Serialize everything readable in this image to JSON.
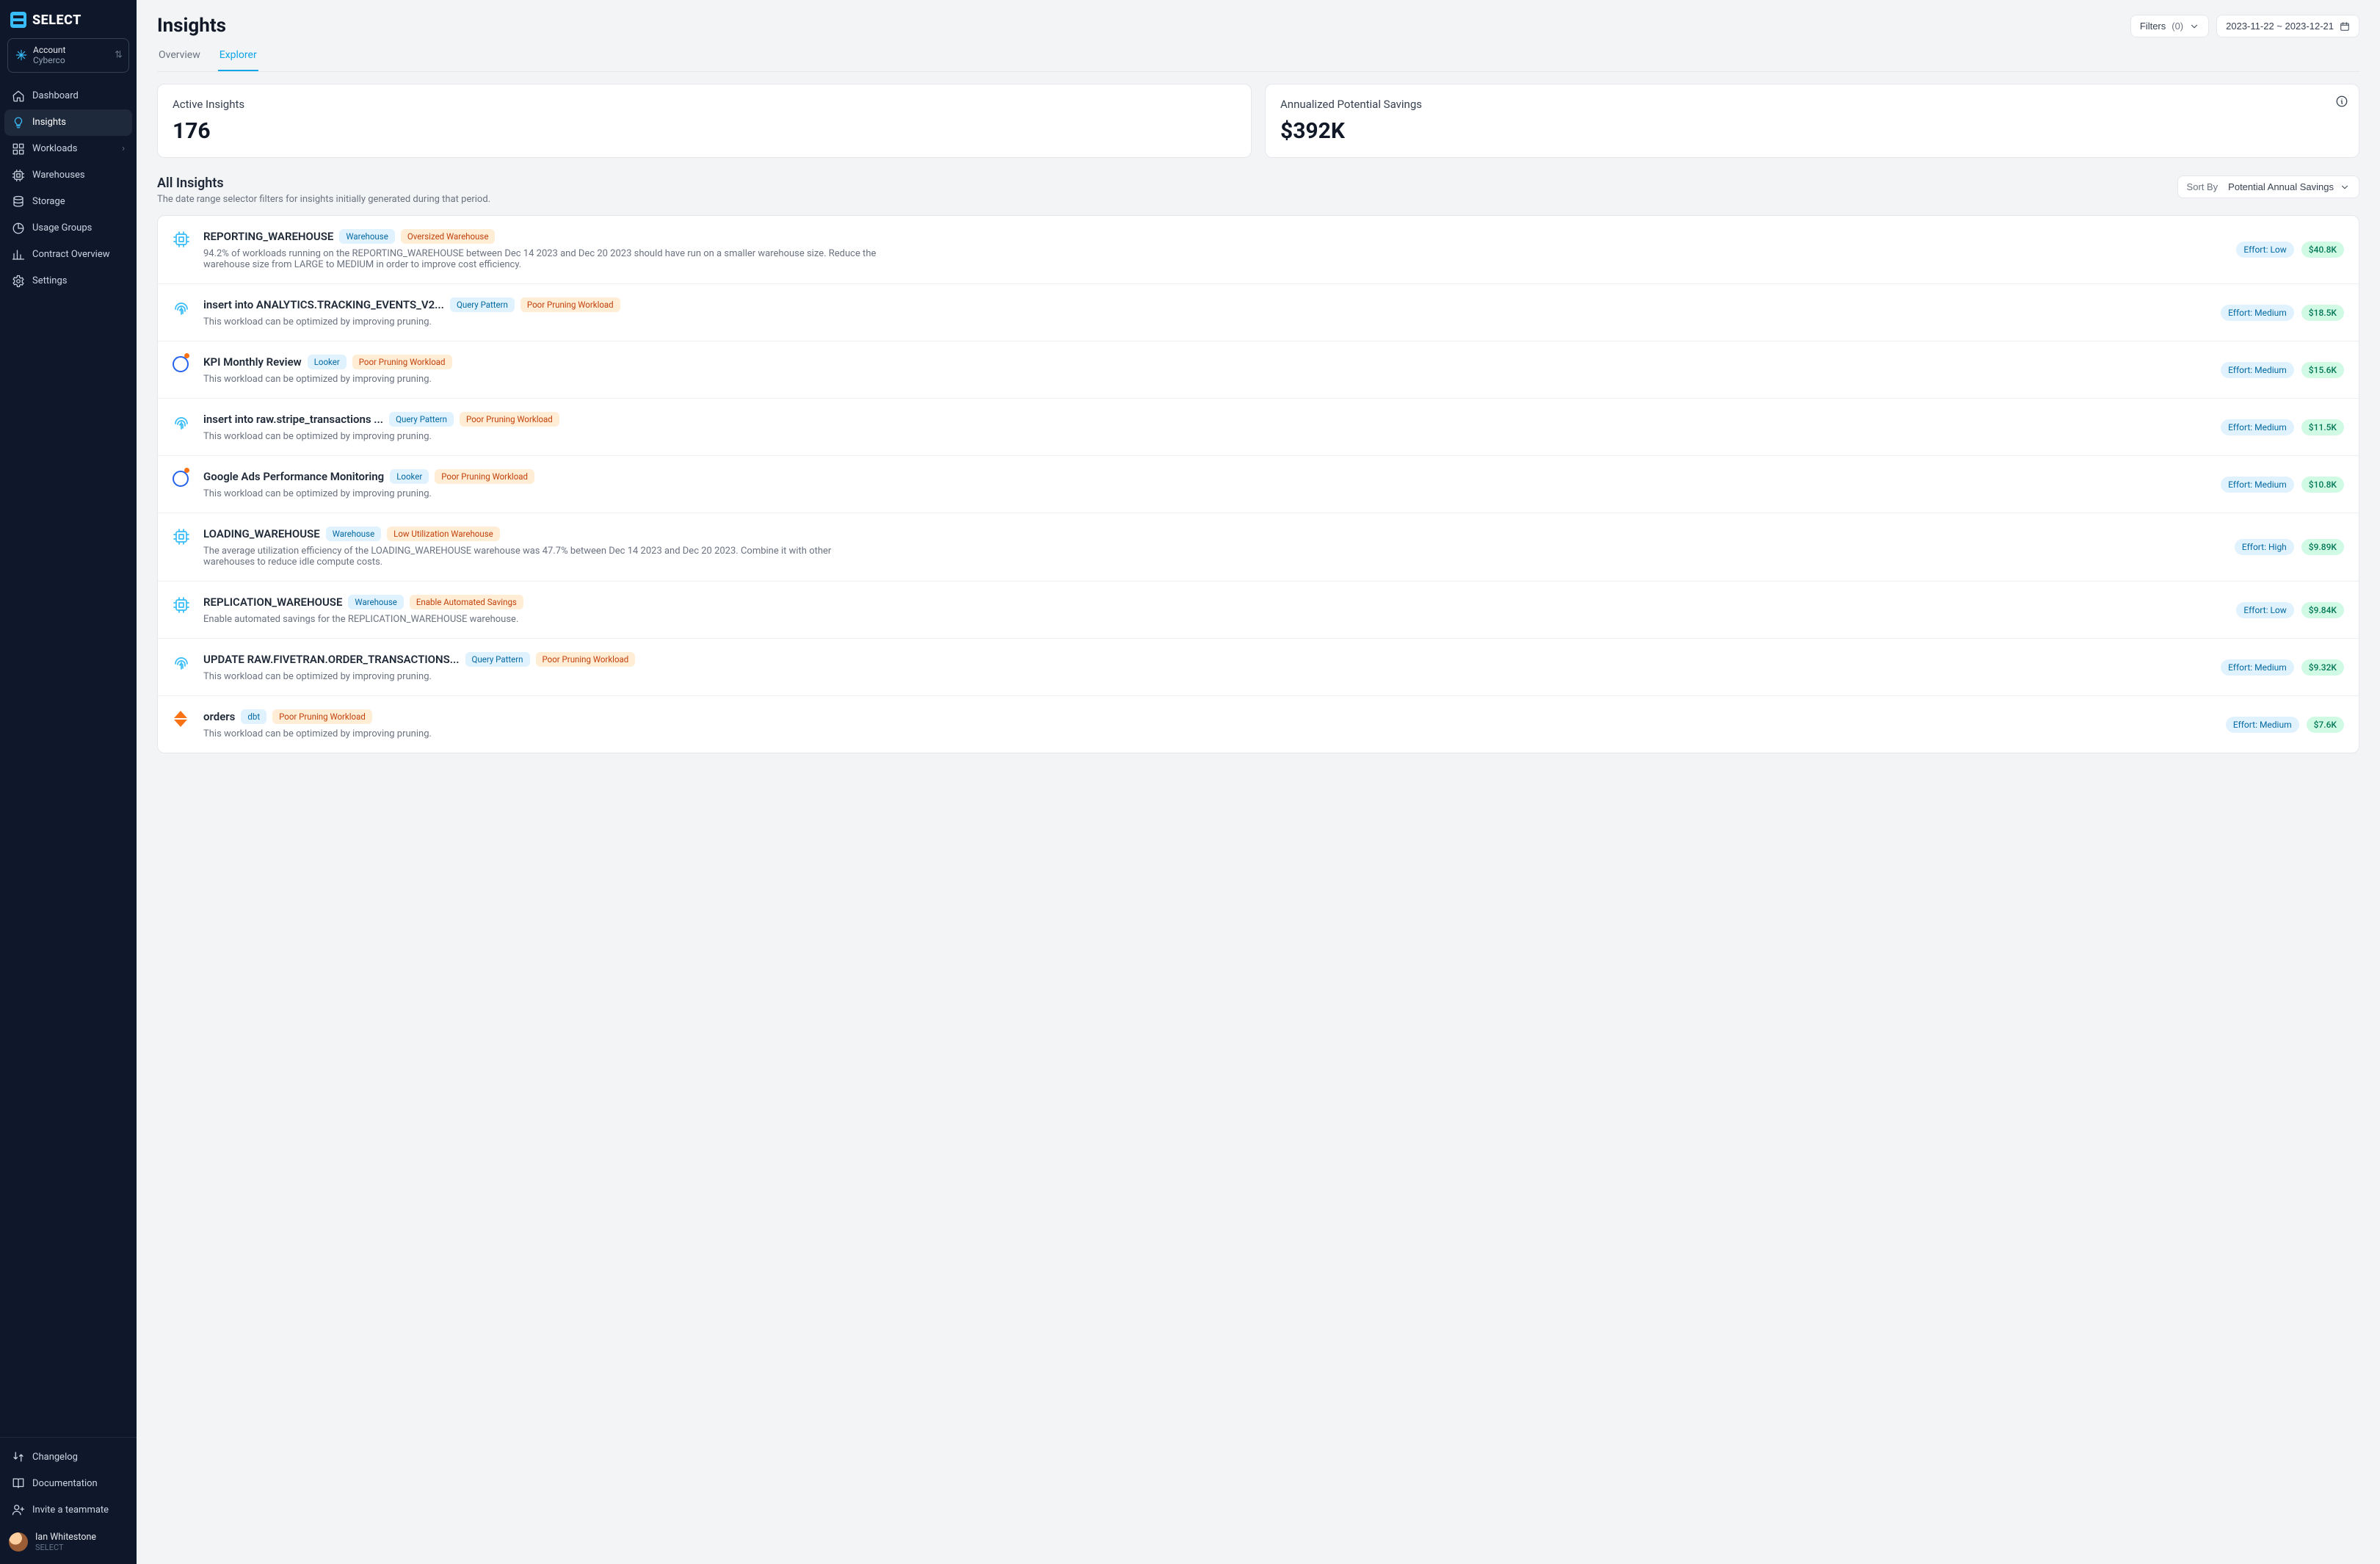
{
  "brand": "SELECT",
  "account": {
    "label": "Account",
    "org": "Cyberco"
  },
  "nav": {
    "dashboard": "Dashboard",
    "insights": "Insights",
    "workloads": "Workloads",
    "warehouses": "Warehouses",
    "storage": "Storage",
    "usage_groups": "Usage Groups",
    "contract_overview": "Contract Overview",
    "settings": "Settings"
  },
  "footer_nav": {
    "changelog": "Changelog",
    "documentation": "Documentation",
    "invite": "Invite a teammate"
  },
  "user": {
    "name": "Ian Whitestone",
    "org": "SELECT"
  },
  "page": {
    "title": "Insights",
    "tabs": {
      "overview": "Overview",
      "explorer": "Explorer"
    },
    "filters_label": "Filters",
    "filters_count": "(0)",
    "date_range": "2023-11-22 ~ 2023-12-21"
  },
  "kpi": {
    "active_label": "Active Insights",
    "active_value": "176",
    "savings_label": "Annualized Potential Savings",
    "savings_value": "$392K"
  },
  "section": {
    "title": "All Insights",
    "subtitle": "The date range selector filters for insights initially generated during that period.",
    "sort_label": "Sort By",
    "sort_value": "Potential Annual Savings"
  },
  "insights": [
    {
      "icon": "chip",
      "title": "REPORTING_WAREHOUSE",
      "tag1": "Warehouse",
      "tag2": "Oversized Warehouse",
      "desc": "94.2% of workloads running on the REPORTING_WAREHOUSE between Dec 14 2023 and Dec 20 2023 should have run on a smaller warehouse size. Reduce the warehouse size from LARGE to MEDIUM in order to improve cost efficiency.",
      "effort": "Effort: Low",
      "savings": "$40.8K"
    },
    {
      "icon": "fingerprint",
      "title": "insert into ANALYTICS.TRACKING_EVENTS_V2...",
      "tag1": "Query Pattern",
      "tag2": "Poor Pruning Workload",
      "desc": "This workload can be optimized by improving pruning.",
      "effort": "Effort: Medium",
      "savings": "$18.5K"
    },
    {
      "icon": "looker",
      "title": "KPI Monthly Review",
      "tag1": "Looker",
      "tag2": "Poor Pruning Workload",
      "desc": "This workload can be optimized by improving pruning.",
      "effort": "Effort: Medium",
      "savings": "$15.6K"
    },
    {
      "icon": "fingerprint",
      "title": "insert into raw.stripe_transactions ...",
      "tag1": "Query Pattern",
      "tag2": "Poor Pruning Workload",
      "desc": "This workload can be optimized by improving pruning.",
      "effort": "Effort: Medium",
      "savings": "$11.5K"
    },
    {
      "icon": "looker",
      "title": "Google Ads Performance Monitoring",
      "tag1": "Looker",
      "tag2": "Poor Pruning Workload",
      "desc": "This workload can be optimized by improving pruning.",
      "effort": "Effort: Medium",
      "savings": "$10.8K"
    },
    {
      "icon": "chip",
      "title": "LOADING_WAREHOUSE",
      "tag1": "Warehouse",
      "tag2": "Low Utilization Warehouse",
      "desc": "The average utilization efficiency of the LOADING_WAREHOUSE warehouse was 47.7% between Dec 14 2023 and Dec 20 2023. Combine it with other warehouses to reduce idle compute costs.",
      "effort": "Effort: High",
      "savings": "$9.89K"
    },
    {
      "icon": "chip",
      "title": "REPLICATION_WAREHOUSE",
      "tag1": "Warehouse",
      "tag2": "Enable Automated Savings",
      "desc": "Enable automated savings for the REPLICATION_WAREHOUSE warehouse.",
      "effort": "Effort: Low",
      "savings": "$9.84K"
    },
    {
      "icon": "fingerprint",
      "title": "UPDATE RAW.FIVETRAN.ORDER_TRANSACTIONS...",
      "tag1": "Query Pattern",
      "tag2": "Poor Pruning Workload",
      "desc": "This workload can be optimized by improving pruning.",
      "effort": "Effort: Medium",
      "savings": "$9.32K"
    },
    {
      "icon": "dbt",
      "title": "orders",
      "tag1": "dbt",
      "tag2": "Poor Pruning Workload",
      "desc": "This workload can be optimized by improving pruning.",
      "effort": "Effort: Medium",
      "savings": "$7.6K"
    }
  ]
}
